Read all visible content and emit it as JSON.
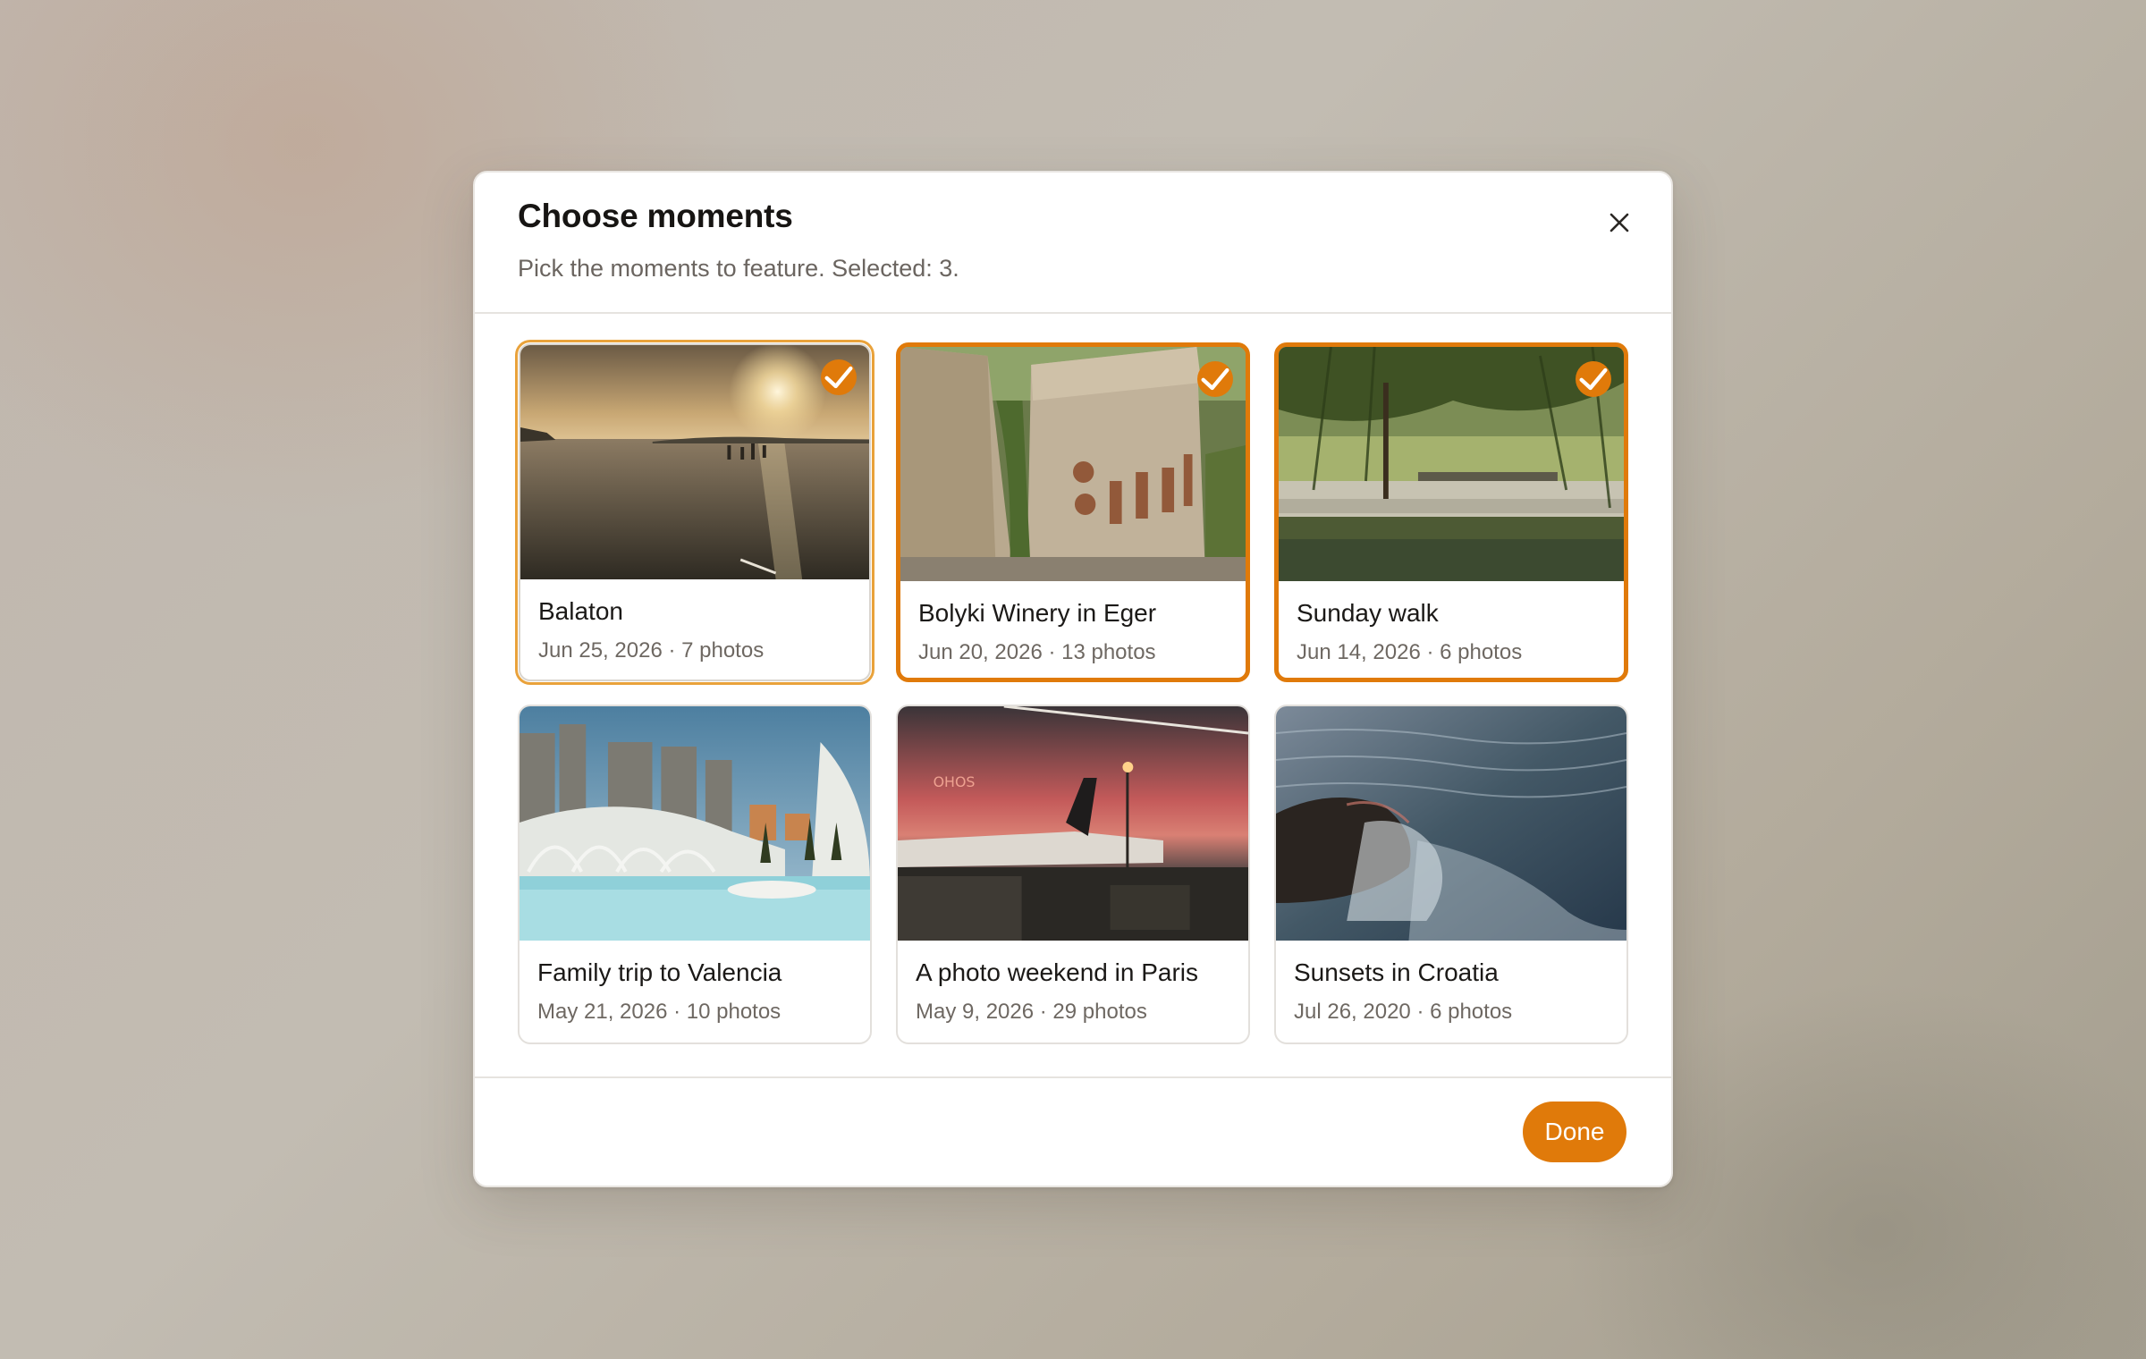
{
  "dialog": {
    "title": "Choose moments",
    "subtitle": "Pick the moments to feature. Selected: 3.",
    "done_label": "Done",
    "accent_color": "#e07a0a"
  },
  "moments": [
    {
      "title": "Balaton",
      "meta": "Jun 25, 2026 · 7 photos",
      "selected": true
    },
    {
      "title": "Bolyki Winery in Eger",
      "meta": "Jun 20, 2026 · 13 photos",
      "selected": true
    },
    {
      "title": "Sunday walk",
      "meta": "Jun 14, 2026 · 6 photos",
      "selected": true
    },
    {
      "title": "Family trip to Valencia",
      "meta": "May 21, 2026 · 10 photos",
      "selected": false
    },
    {
      "title": "A photo weekend in Paris",
      "meta": "May 9, 2026 · 29 photos",
      "selected": false
    },
    {
      "title": "Sunsets in Croatia",
      "meta": "Jul 26, 2020 · 6 photos",
      "selected": false
    }
  ],
  "icons": {
    "close": "close-icon",
    "check": "check-icon"
  }
}
